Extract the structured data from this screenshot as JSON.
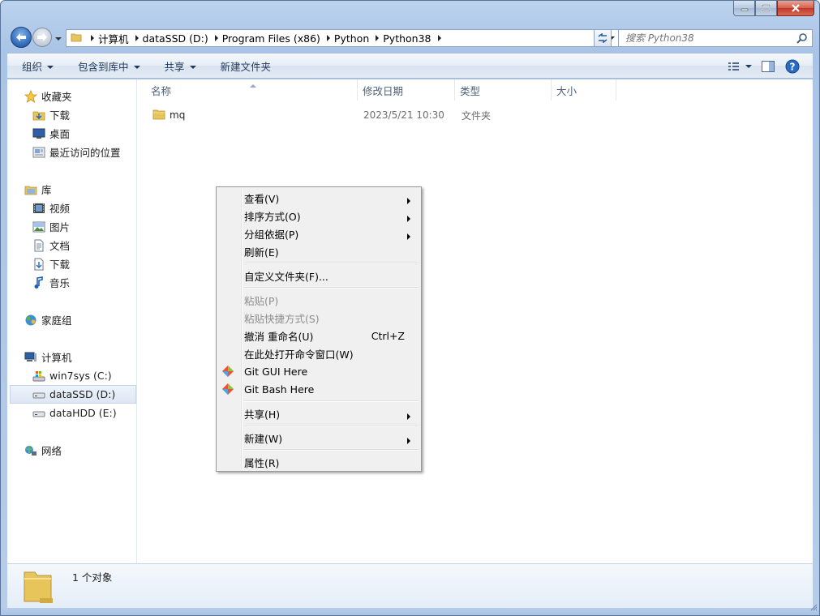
{
  "address": {
    "crumbs": [
      "计算机",
      "dataSSD (D:)",
      "Program Files (x86)",
      "Python",
      "Python38"
    ]
  },
  "search": {
    "placeholder": "搜索 Python38"
  },
  "toolbar": {
    "organize": "组织",
    "include_in_library": "包含到库中",
    "share": "共享",
    "new_folder": "新建文件夹"
  },
  "nav_pane": {
    "favorites": {
      "label": "收藏夹",
      "items": [
        "下载",
        "桌面",
        "最近访问的位置"
      ]
    },
    "libraries": {
      "label": "库",
      "items": [
        "视频",
        "图片",
        "文档",
        "下载",
        "音乐"
      ]
    },
    "homegroup": "家庭组",
    "computer": {
      "label": "计算机",
      "drives": [
        "win7sys (C:)",
        "dataSSD (D:)",
        "dataHDD (E:)"
      ]
    },
    "network": "网络"
  },
  "columns": {
    "name": "名称",
    "date": "修改日期",
    "type": "类型",
    "size": "大小"
  },
  "files": [
    {
      "name": "mq",
      "date": "2023/5/21 10:30",
      "type": "文件夹",
      "size": ""
    }
  ],
  "context_menu": {
    "view": "查看(V)",
    "sort": "排序方式(O)",
    "group": "分组依据(P)",
    "refresh": "刷新(E)",
    "customize": "自定义文件夹(F)...",
    "paste": "粘贴(P)",
    "paste_shortcut": "粘贴快捷方式(S)",
    "undo_rename": "撤消 重命名(U)",
    "undo_shortcut": "Ctrl+Z",
    "open_cmd": "在此处打开命令窗口(W)",
    "git_gui": "Git GUI Here",
    "git_bash": "Git Bash Here",
    "share": "共享(H)",
    "new": "新建(W)",
    "properties": "属性(R)"
  },
  "details": {
    "count": "1 个对象"
  }
}
